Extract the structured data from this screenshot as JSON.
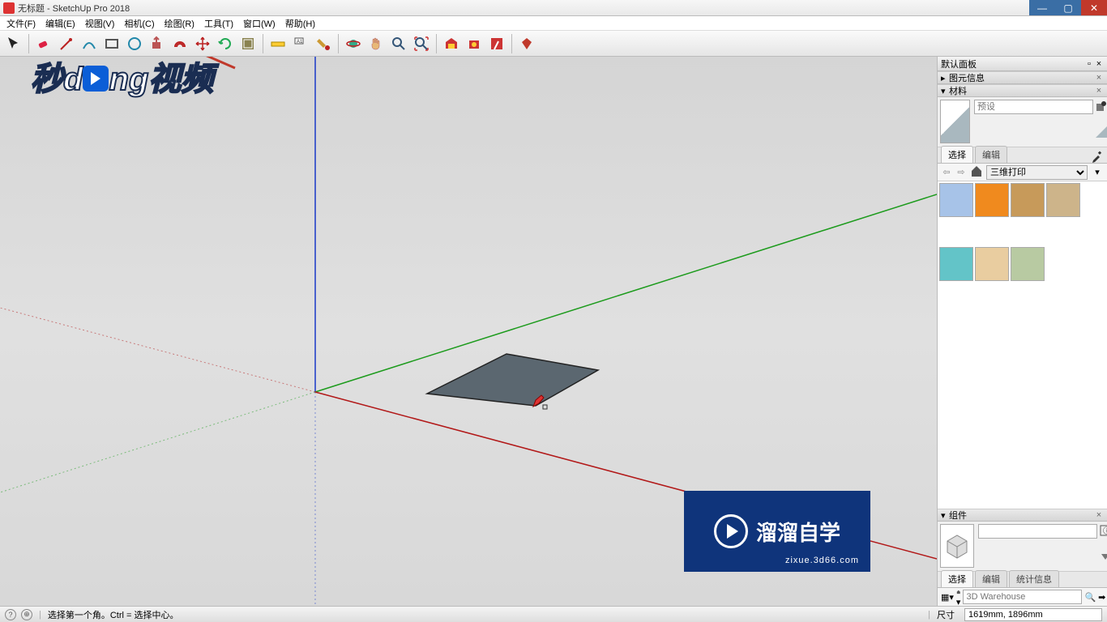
{
  "title": "无标题 - SketchUp Pro 2018",
  "menu": [
    "文件(F)",
    "编辑(E)",
    "视图(V)",
    "相机(C)",
    "绘图(R)",
    "工具(T)",
    "窗口(W)",
    "帮助(H)"
  ],
  "panel": {
    "default_tray": "默认面板",
    "entity_info": "图元信息",
    "materials": "材料",
    "components": "组件",
    "preset_placeholder": "预设",
    "tab_select": "选择",
    "tab_edit": "编辑",
    "tab_stats": "统计信息",
    "category_selected": "三维打印",
    "search_placeholder": "3D Warehouse"
  },
  "swatches": [
    "#a7c3e8",
    "#f08a1e",
    "#c79a5a",
    "#cdb48a",
    "#63c4c8",
    "#e9cda0",
    "#b8caa2"
  ],
  "status": {
    "message": "选择第一个角。Ctrl = 选择中心。",
    "dim_label": "尺寸",
    "dim_value": "1619mm, 1896mm"
  },
  "watermark": {
    "text": "溜溜自学",
    "url": "zixue.3d66.com"
  },
  "logo_overlay": "秒dong视频"
}
